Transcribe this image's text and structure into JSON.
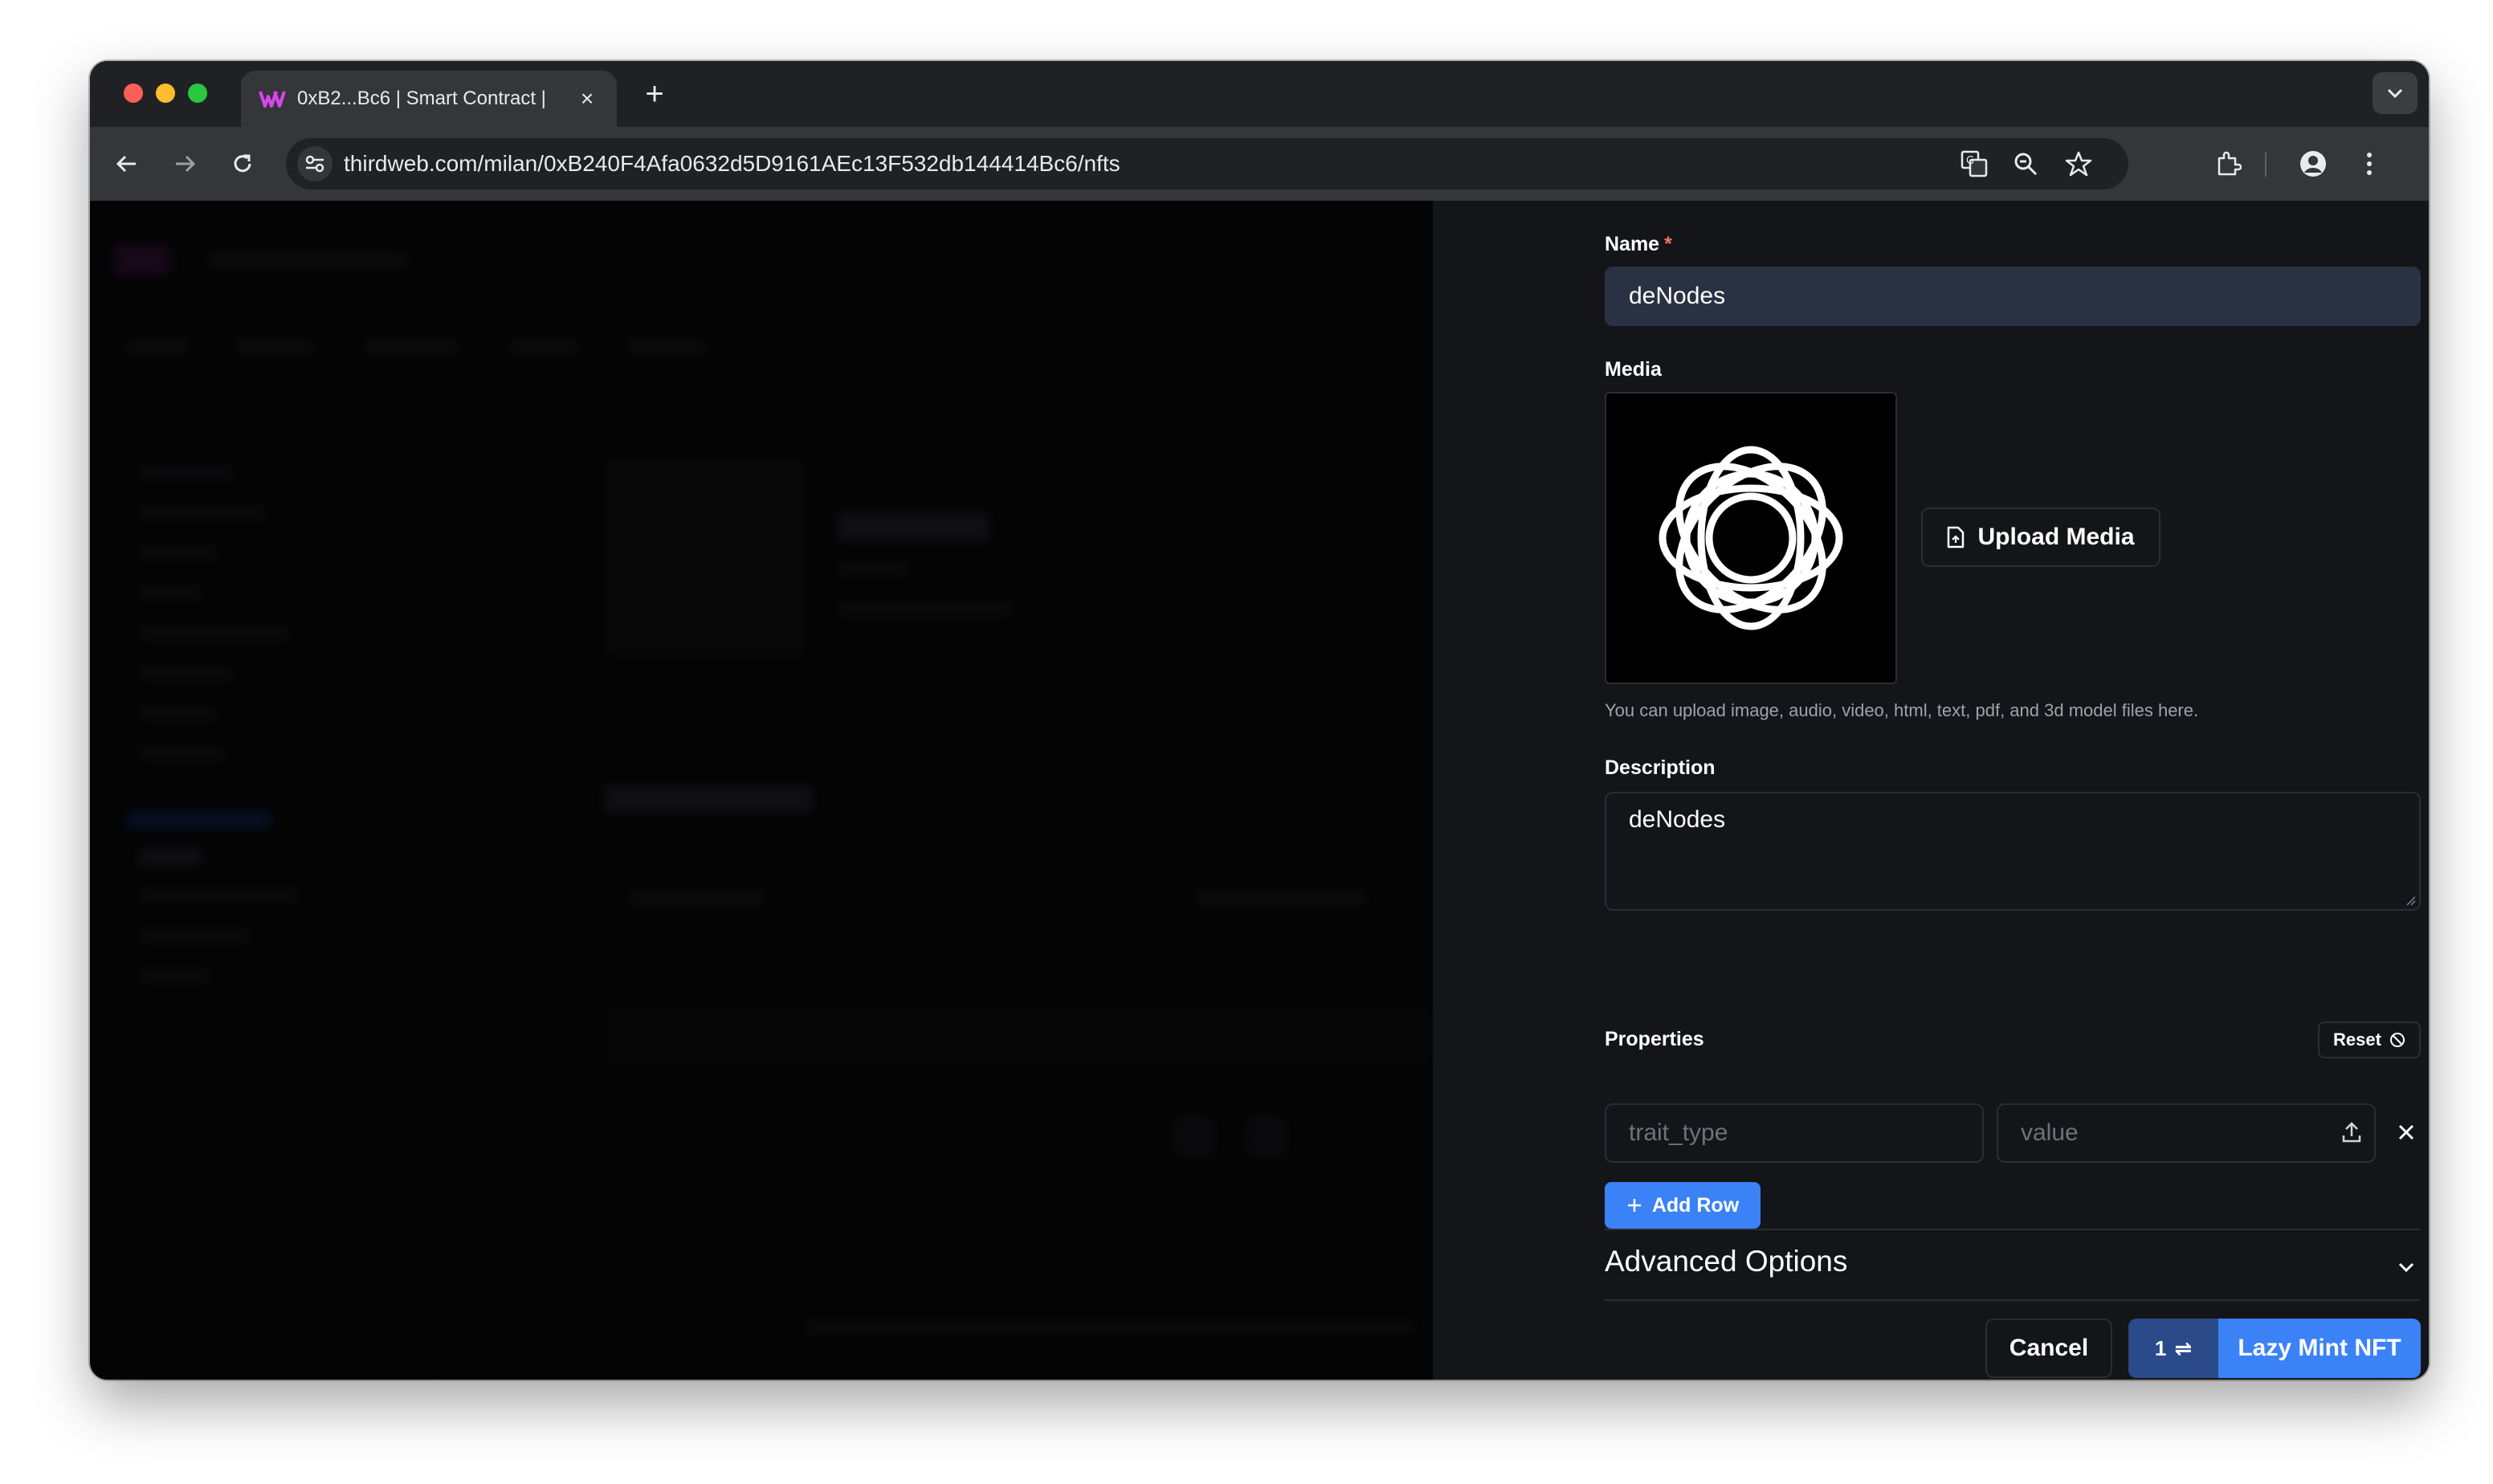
{
  "browser": {
    "tab_title": "0xB2...Bc6 | Smart Contract |",
    "url_host": "thirdweb.com",
    "url_path": "/milan/0xB240F4Afa0632d5D9161AEc13F532db144414Bc6/nfts"
  },
  "drawer": {
    "name_label": "Name",
    "required_mark": "*",
    "name_value": "deNodes",
    "media_label": "Media",
    "upload_media_label": "Upload Media",
    "media_helper": "You can upload image, audio, video, html, text, pdf, and 3d model files here.",
    "description_label": "Description",
    "description_value": "deNodes",
    "properties_label": "Properties",
    "reset_label": "Reset",
    "trait_placeholder": "trait_type",
    "value_placeholder": "value",
    "add_row_label": "Add Row",
    "advanced_options_label": "Advanced Options",
    "cancel_label": "Cancel",
    "quantity_label": "1",
    "quantity_icon": "⇌",
    "submit_label": "Lazy Mint NFT"
  }
}
